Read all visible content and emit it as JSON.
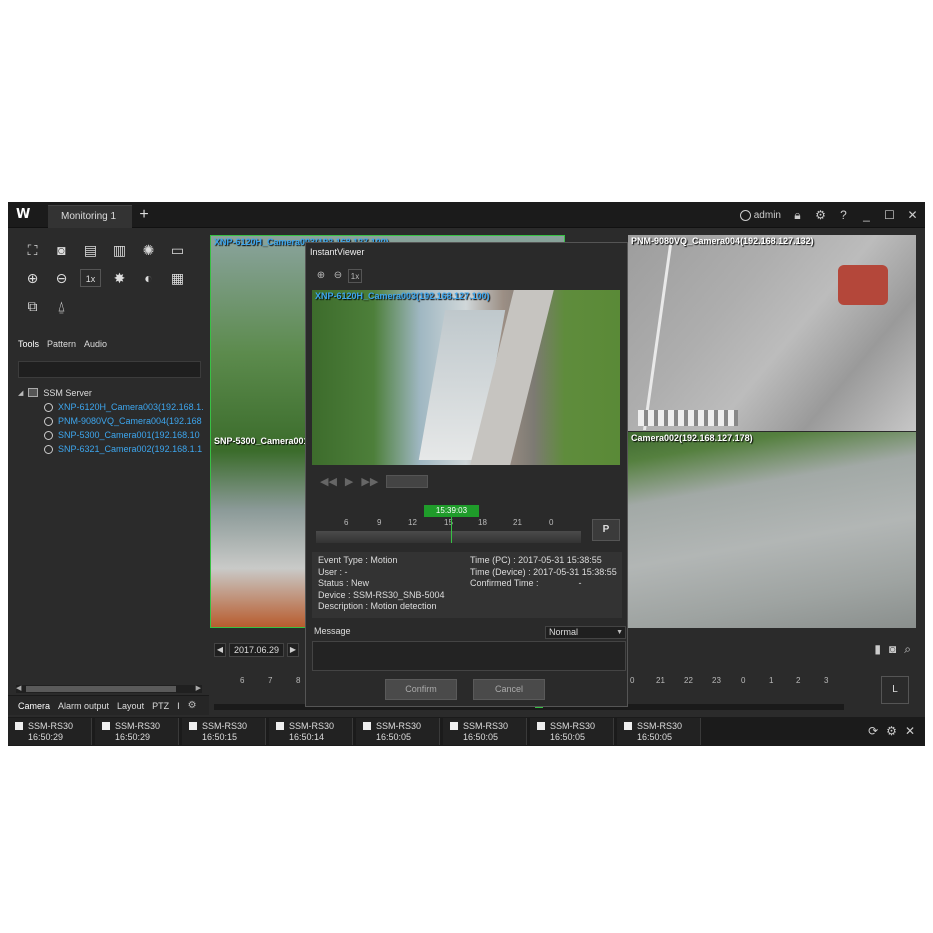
{
  "app": {
    "logo": "W",
    "tab_label": "Monitoring 1",
    "add_tab": "+",
    "user": "admin",
    "titlebar_icons": [
      "lock-icon",
      "gear-icon",
      "help-icon",
      "minimize-icon",
      "maximize-icon",
      "close-icon"
    ]
  },
  "left_panel": {
    "tools_row1": [
      "fullscreen-icon",
      "snapshot-icon",
      "print-icon",
      "record-icon",
      "alarm-icon",
      "monitor-icon"
    ],
    "tools_row2": [
      "zoom-in-icon",
      "zoom-out-icon",
      "1x",
      "brightness-icon",
      "contrast-icon",
      "layout-icon"
    ],
    "tools_row3": [
      "cursor-icon",
      "siren-icon"
    ],
    "subtabs": [
      "Tools",
      "Pattern",
      "Audio"
    ],
    "tree": {
      "server": "SSM Server",
      "cameras": [
        "XNP-6120H_Camera003(192.168.1.",
        "PNM-9080VQ_Camera004(192.168",
        "SNP-5300_Camera001(192.168.10",
        "SNP-6321_Camera002(192.168.1.1"
      ]
    },
    "bottom_tabs": [
      "Camera",
      "Alarm output",
      "Layout",
      "PTZ",
      "I"
    ]
  },
  "cameras": {
    "cam1_label": "XNP-6120H_Camera003(192.168.127.100)",
    "cam1b_label": "SNP-5300_Camera001",
    "cam2_label": "PNM-9080VQ_Camera004(192.168.127.132)",
    "cam3_label": "Camera002(192.168.127.178)"
  },
  "playback": {
    "date": "2017.06.29",
    "timeline_ticks": [
      "0",
      "21",
      "22",
      "23",
      "0",
      "1",
      "2",
      "3"
    ],
    "left_ticks": [
      "6",
      "7",
      "8"
    ],
    "layout_button": "L"
  },
  "instant_viewer": {
    "title": "InstantViewer",
    "zoom_1x": "1x",
    "video_label": "XNP-6120H_Camera003(192.168.127.100)",
    "current_time": "15:39:03",
    "ticks": [
      "6",
      "9",
      "12",
      "15",
      "18",
      "21",
      "0"
    ],
    "p_button": "P",
    "info": {
      "event_type": "Event Type : Motion",
      "user": "User : -",
      "status": "Status : New",
      "device": "Device : SSM-RS30_SNB-5004",
      "description": "Description : Motion detection",
      "time_pc": "Time (PC) : 2017-05-31 15:38:55",
      "time_device": "Time (Device) : 2017-05-31 15:38:55",
      "confirmed_time": "Confirmed Time :",
      "confirmed_value": "-"
    },
    "message_label": "Message",
    "priority": "Normal",
    "confirm": "Confirm",
    "cancel": "Cancel"
  },
  "events": [
    {
      "name": "SSM-RS30",
      "time": "16:50:29"
    },
    {
      "name": "SSM-RS30",
      "time": "16:50:29"
    },
    {
      "name": "SSM-RS30",
      "time": "16:50:15"
    },
    {
      "name": "SSM-RS30",
      "time": "16:50:14"
    },
    {
      "name": "SSM-RS30",
      "time": "16:50:05"
    },
    {
      "name": "SSM-RS30",
      "time": "16:50:05"
    },
    {
      "name": "SSM-RS30",
      "time": "16:50:05"
    },
    {
      "name": "SSM-RS30",
      "time": "16:50:05"
    }
  ]
}
